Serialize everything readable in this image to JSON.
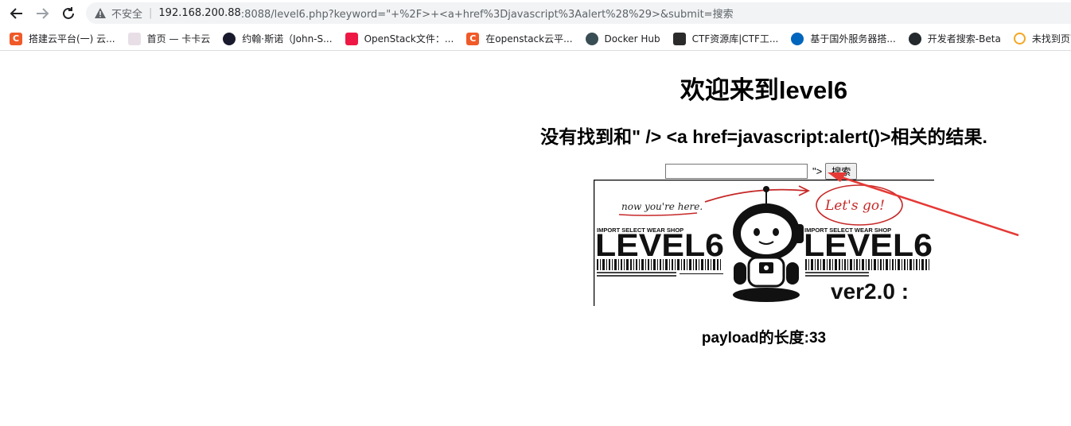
{
  "browser": {
    "security_label": "不安全",
    "url_host": "192.168.200.88",
    "url_rest": ":8088/level6.php?keyword=\"+%2F>+<a+href%3Djavascript%3Aalert%28%29>&submit=搜索",
    "bookmarks": [
      {
        "label": "搭建云平台(一) 云...",
        "icon": "csdn-icon",
        "color": "#f05a28",
        "glyph": "C"
      },
      {
        "label": "首页 — 卡卡云",
        "icon": "kakayun-icon",
        "color": "#e8dfe6",
        "glyph": ""
      },
      {
        "label": "约翰·斯诺（John-S...",
        "icon": "john-snow-icon",
        "color": "#1a1a2e",
        "glyph": ""
      },
      {
        "label": "OpenStack文件：...",
        "icon": "openstack-icon",
        "color": "#ed1944",
        "glyph": ""
      },
      {
        "label": "在openstack云平...",
        "icon": "csdn-icon",
        "color": "#f05a28",
        "glyph": "C"
      },
      {
        "label": "Docker Hub",
        "icon": "docker-icon",
        "color": "#394d54",
        "glyph": ""
      },
      {
        "label": "CTF资源库|CTF工...",
        "icon": "ctf-icon",
        "color": "#2b2b2b",
        "glyph": ""
      },
      {
        "label": "基于国外服务器搭...",
        "icon": "scotland-flag-icon",
        "color": "#0065bd",
        "glyph": ""
      },
      {
        "label": "开发者搜索-Beta",
        "icon": "github-icon",
        "color": "#24292e",
        "glyph": ""
      },
      {
        "label": "未找到页面 |",
        "icon": "loading-circle-icon",
        "color": "#f5a623",
        "glyph": ""
      }
    ]
  },
  "page": {
    "title": "欢迎来到level6",
    "result_text": "没有找到和\" /> <a href=javascript:alert()>相关的结果.",
    "keyword_value": "",
    "leaked_text": "\">",
    "submit_label": "搜索",
    "payload_length": "payload的长度:33"
  },
  "banner": {
    "handwritten_left": "now you're here.",
    "handwritten_right": "Let's go!",
    "shop_left": "IMPORT SELECT WEAR SHOP",
    "shop_right": "IMPORT SELECT WEAR SHOP",
    "level_left": "LEVEL6",
    "level_right": "LEVEL6",
    "version": "ver2.0 :"
  },
  "colors": {
    "annotation_red": "#e53935"
  }
}
